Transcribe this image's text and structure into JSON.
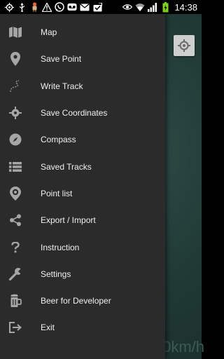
{
  "status_bar": {
    "time": "14:38",
    "battery_color": "#7ed321"
  },
  "map": {
    "speed_fragment": "0km/h"
  },
  "drawer": {
    "items": [
      {
        "label": "Map",
        "icon": "map-icon"
      },
      {
        "label": "Save Point",
        "icon": "location-pin-icon"
      },
      {
        "label": "Write Track",
        "icon": "track-path-icon"
      },
      {
        "label": "Save Coordinates",
        "icon": "crosshair-icon"
      },
      {
        "label": "Compass",
        "icon": "compass-icon"
      },
      {
        "label": "Saved Tracks",
        "icon": "list-icon"
      },
      {
        "label": "Point list",
        "icon": "pin-list-icon"
      },
      {
        "label": "Export / Import",
        "icon": "share-icon"
      },
      {
        "label": "Instruction",
        "icon": "question-icon"
      },
      {
        "label": "Settings",
        "icon": "wrench-icon"
      },
      {
        "label": "Beer for Developer",
        "icon": "beer-mug-icon"
      },
      {
        "label": "Exit",
        "icon": "exit-icon"
      }
    ]
  }
}
